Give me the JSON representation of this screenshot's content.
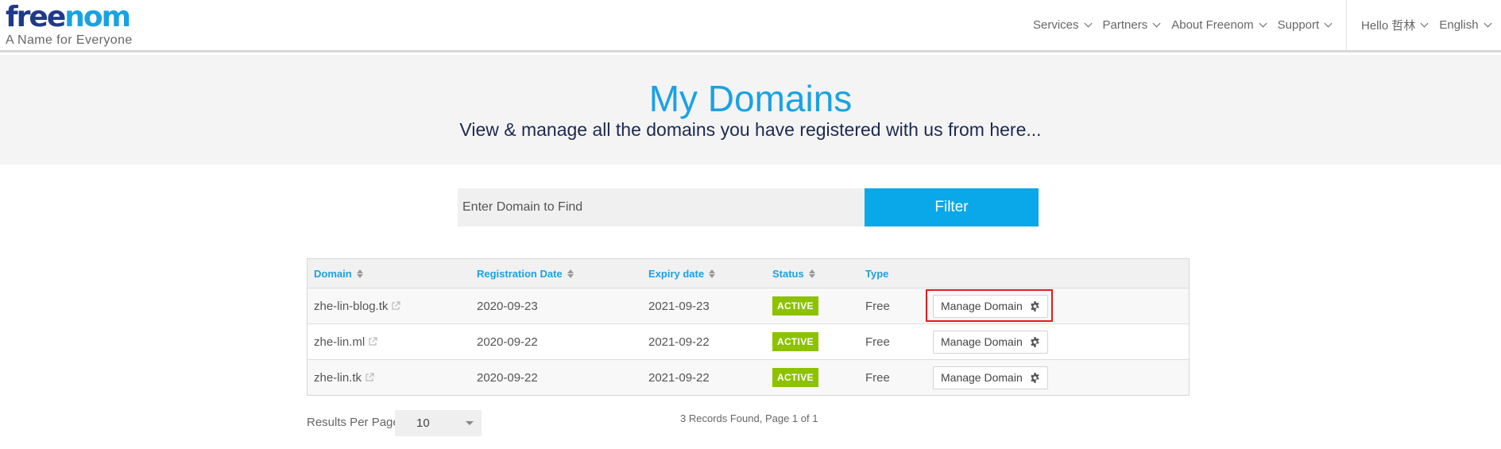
{
  "header": {
    "logo_part1": "free",
    "logo_part2": "nom",
    "tagline": "A Name for Everyone",
    "nav": [
      "Services",
      "Partners",
      "About Freenom",
      "Support"
    ],
    "user_greeting": "Hello 哲林",
    "language": "English"
  },
  "banner": {
    "title": "My Domains",
    "subtitle": "View & manage all the domains you have registered with us from here..."
  },
  "search": {
    "placeholder": "Enter Domain to Find",
    "button_label": "Filter"
  },
  "table": {
    "headers": {
      "domain": "Domain",
      "registration": "Registration Date",
      "expiry": "Expiry date",
      "status": "Status",
      "type": "Type"
    },
    "rows": [
      {
        "domain": "zhe-lin-blog.tk",
        "registration": "2020-09-23",
        "expiry": "2021-09-23",
        "status": "ACTIVE",
        "type": "Free",
        "action": "Manage Domain"
      },
      {
        "domain": "zhe-lin.ml",
        "registration": "2020-09-22",
        "expiry": "2021-09-22",
        "status": "ACTIVE",
        "type": "Free",
        "action": "Manage Domain"
      },
      {
        "domain": "zhe-lin.tk",
        "registration": "2020-09-22",
        "expiry": "2021-09-22",
        "status": "ACTIVE",
        "type": "Free",
        "action": "Manage Domain"
      }
    ]
  },
  "footer": {
    "results_label": "Results Per Page:",
    "results_value": "10",
    "records_text": "3 Records Found, Page 1 of 1"
  },
  "colors": {
    "brand_blue": "#1aa2e3",
    "brand_navy": "#1f3a8a",
    "filter_button": "#0aa8e8",
    "active_badge": "#8dc200",
    "highlight_box": "#e31b1b"
  }
}
